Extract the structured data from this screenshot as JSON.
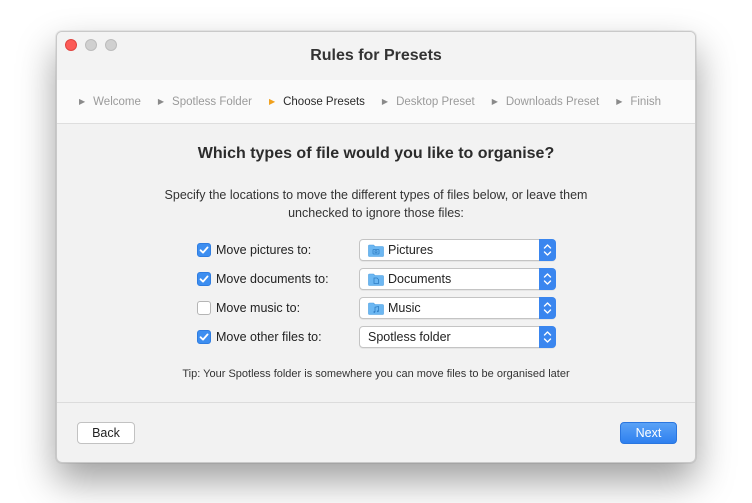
{
  "window": {
    "title": "Rules for Presets"
  },
  "steps": [
    {
      "label": "Welcome",
      "active": false
    },
    {
      "label": "Spotless Folder",
      "active": false
    },
    {
      "label": "Choose Presets",
      "active": true
    },
    {
      "label": "Desktop Preset",
      "active": false
    },
    {
      "label": "Downloads Preset",
      "active": false
    },
    {
      "label": "Finish",
      "active": false
    }
  ],
  "main": {
    "heading": "Which types of file would you like to organise?",
    "description_line1": "Specify the locations to move the different types of files below, or leave them",
    "description_line2": "unchecked to ignore those files:",
    "rules": [
      {
        "label": "Move pictures to:",
        "checked": true,
        "destination": "Pictures",
        "icon": "pictures-folder-icon"
      },
      {
        "label": "Move documents to:",
        "checked": true,
        "destination": "Documents",
        "icon": "documents-folder-icon"
      },
      {
        "label": "Move music to:",
        "checked": false,
        "destination": "Music",
        "icon": "music-folder-icon"
      },
      {
        "label": "Move other files to:",
        "checked": true,
        "destination": "Spotless folder",
        "icon": ""
      }
    ],
    "tip": "Tip: Your Spotless folder is somewhere you can move files to be organised later"
  },
  "footer": {
    "back_label": "Back",
    "next_label": "Next"
  },
  "colors": {
    "accent": "#3a86ef",
    "active_step_arrow": "#f0a01c",
    "close_button": "#fc5b57"
  }
}
